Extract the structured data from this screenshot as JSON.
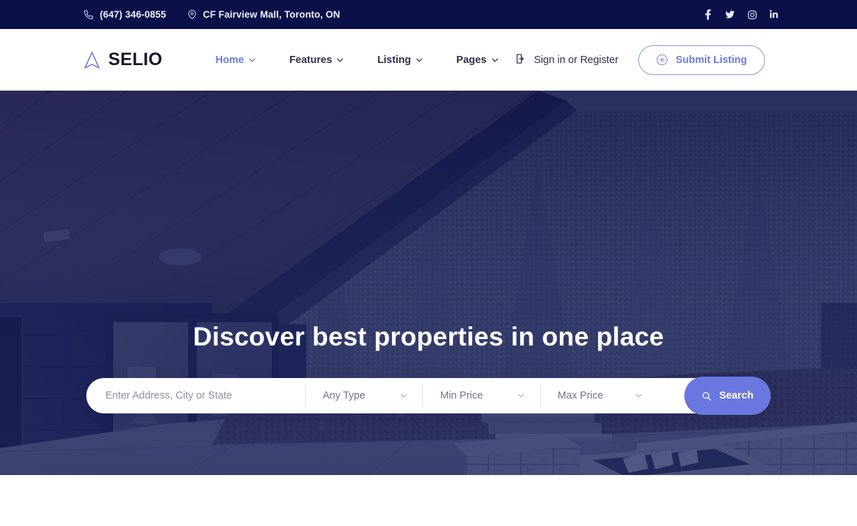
{
  "topbar": {
    "phone": {
      "icon": "phone-icon",
      "text": "(647) 346-0855"
    },
    "address": {
      "icon": "map-pin-icon",
      "text": "CF Fairview Mall, Toronto, ON"
    },
    "social": [
      {
        "name": "facebook-icon",
        "label": "Facebook"
      },
      {
        "name": "twitter-icon",
        "label": "Twitter"
      },
      {
        "name": "instagram-icon",
        "label": "Instagram"
      },
      {
        "name": "linkedin-icon",
        "label": "LinkedIn"
      }
    ],
    "background_color": "#0b1049",
    "text_color": "#eef0fb"
  },
  "header": {
    "logo": {
      "icon": "selio-triangle-logo",
      "name": "SELIO",
      "mark_color": "#7b87e6",
      "text_color": "#171a2b"
    },
    "nav": [
      {
        "label": "Home",
        "active": true,
        "has_dropdown": true
      },
      {
        "label": "Features",
        "active": false,
        "has_dropdown": true
      },
      {
        "label": "Listing",
        "active": false,
        "has_dropdown": true
      },
      {
        "label": "Pages",
        "active": false,
        "has_dropdown": true
      }
    ],
    "sign_in": {
      "icon": "login-icon",
      "label": "Sign in or Register"
    },
    "submit_listing": {
      "icon": "plus-circle-icon",
      "label": "Submit Listing"
    },
    "accent_color": "#6c79e0"
  },
  "hero": {
    "title": "Discover best properties in one place",
    "overlay_color": "#0e1346",
    "image_description": "Covered patio with wood plank ceiling, navy siding, sliding glass doors, evergreen trees, stone fire pit and steps"
  },
  "search": {
    "address": {
      "placeholder": "Enter Address, City or State",
      "value": ""
    },
    "type": {
      "label": "Any Type",
      "icon": "chevron-down-icon"
    },
    "min_price": {
      "label": "Min Price",
      "icon": "chevron-down-icon"
    },
    "max_price": {
      "label": "Max Price",
      "icon": "chevron-down-icon"
    },
    "button": {
      "label": "Search",
      "icon": "search-icon",
      "color": "#6a77e0"
    }
  }
}
